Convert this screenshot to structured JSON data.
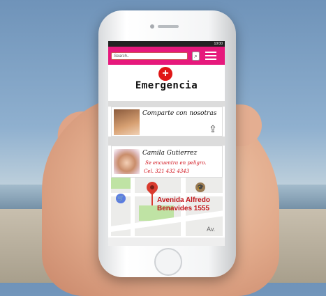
{
  "status_time": "10:00",
  "search": {
    "placeholder": "Search.."
  },
  "header": {
    "title": "Emergencia"
  },
  "share_card": {
    "title": "Comparte con nosotras"
  },
  "contact_card": {
    "name": "Camila Gutierrez",
    "status": "Se encuentra en peligro.",
    "phone": "Cel. 321 432 4343"
  },
  "map": {
    "address_line1": "Avenida Alfredo",
    "address_line2": "Benavides 1555",
    "street_label": "Av."
  },
  "icons": [
    "search-icon",
    "menu-icon",
    "red-cross-icon",
    "share-icon",
    "map-pin-icon",
    "shop-icon",
    "school-icon"
  ],
  "colors": {
    "brand": "#e6197c",
    "alert": "#d0101a"
  }
}
